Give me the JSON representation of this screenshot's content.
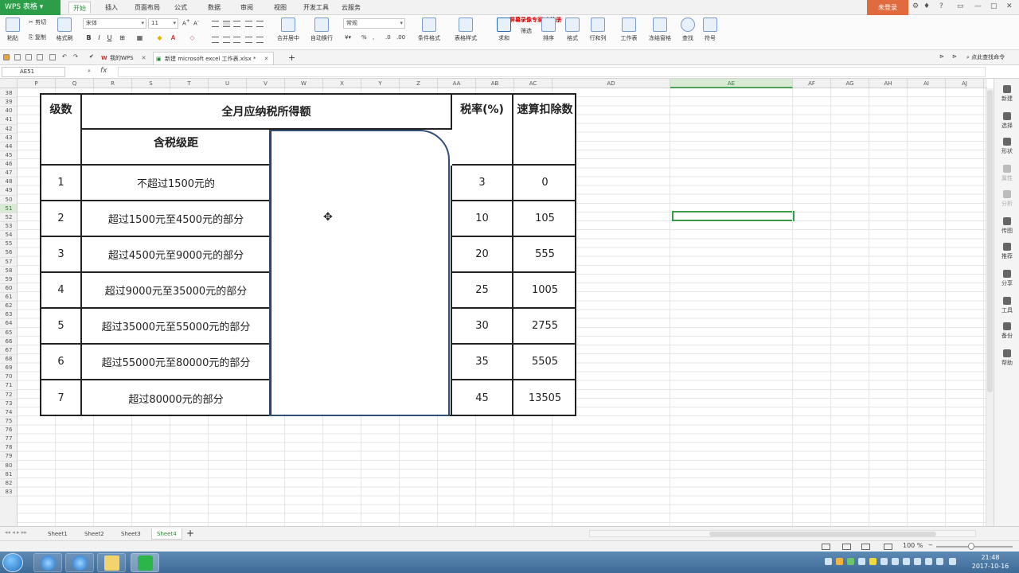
{
  "app": {
    "name": "WPS 表格",
    "login": "未登录"
  },
  "menu": {
    "tabs": [
      "开始",
      "插入",
      "页面布局",
      "公式",
      "数据",
      "审阅",
      "视图",
      "开发工具",
      "云服务"
    ],
    "active": "开始"
  },
  "ribbon": {
    "paste": "粘贴",
    "cut": "剪切",
    "copy": "复制",
    "format_painter": "格式刷",
    "font_name": "宋体",
    "font_size": "11",
    "number_format": "常规",
    "merge_center": "合并居中",
    "wrap_text": "自动换行",
    "cond_format": "条件格式",
    "table_style": "表格样式",
    "sum": "求和",
    "filter": "筛选",
    "sort": "排序",
    "format": "格式",
    "rows_cols": "行和列",
    "worksheet": "工作表",
    "freeze": "冻结窗格",
    "find": "查找",
    "symbol": "符号",
    "warning": "屏幕录像专家 未注册"
  },
  "doc_tabs": [
    {
      "label": "我的WPS"
    },
    {
      "label": "新建 microsoft excel 工作表.xlsx *"
    }
  ],
  "search_hint": "点此查找命令",
  "formula_bar": {
    "name_box": "AE51",
    "fx": "fx",
    "value": ""
  },
  "columns": [
    "P",
    "Q",
    "R",
    "S",
    "T",
    "U",
    "V",
    "W",
    "X",
    "Y",
    "Z",
    "AA",
    "AB",
    "AC",
    "AD",
    "AE",
    "AF",
    "AG",
    "AH",
    "AI",
    "AJ"
  ],
  "selected_column": "AE",
  "rows": [
    38,
    39,
    40,
    41,
    42,
    43,
    44,
    45,
    46,
    47,
    48,
    49,
    50,
    51,
    52,
    53,
    54,
    55,
    56,
    57,
    58,
    59,
    60,
    61,
    62,
    63,
    64,
    65,
    66,
    67,
    68,
    69,
    70,
    71,
    72,
    73,
    74,
    75,
    76,
    77,
    78,
    79,
    80,
    81,
    82,
    83
  ],
  "selected_row": 51,
  "tax_table": {
    "header_level": "级数",
    "header_income": "全月应纳税所得额",
    "header_bracket": "含税级距",
    "header_rate": "税率(%)",
    "header_deduction": "速算扣除数",
    "rows": [
      {
        "level": "1",
        "bracket": "不超过1500元的",
        "rate": "3",
        "deduction": "0"
      },
      {
        "level": "2",
        "bracket": "超过1500元至4500元的部分",
        "rate": "10",
        "deduction": "105"
      },
      {
        "level": "3",
        "bracket": "超过4500元至9000元的部分",
        "rate": "20",
        "deduction": "555"
      },
      {
        "level": "4",
        "bracket": "超过9000元至35000元的部分",
        "rate": "25",
        "deduction": "1005"
      },
      {
        "level": "5",
        "bracket": "超过35000元至55000元的部分",
        "rate": "30",
        "deduction": "2755"
      },
      {
        "level": "6",
        "bracket": "超过55000元至80000元的部分",
        "rate": "35",
        "deduction": "5505"
      },
      {
        "level": "7",
        "bracket": "超过80000元的部分",
        "rate": "45",
        "deduction": "13505"
      }
    ]
  },
  "right_sidebar": [
    {
      "label": "新建",
      "dim": false
    },
    {
      "label": "选择",
      "dim": false
    },
    {
      "label": "形状",
      "dim": false
    },
    {
      "label": "属性",
      "dim": true
    },
    {
      "label": "分析",
      "dim": true
    },
    {
      "label": "传图",
      "dim": false
    },
    {
      "label": "推荐",
      "dim": false
    },
    {
      "label": "分享",
      "dim": false
    },
    {
      "label": "工具",
      "dim": false
    },
    {
      "label": "备份",
      "dim": false
    },
    {
      "label": "帮助",
      "dim": false
    }
  ],
  "sheets": [
    "Sheet1",
    "Sheet2",
    "Sheet3",
    "Sheet4"
  ],
  "active_sheet": "Sheet4",
  "status": {
    "zoom": "100 %"
  },
  "clock": {
    "time": "21:48",
    "date": "2017-10-16"
  },
  "colors": {
    "accent": "#2c9e4a",
    "shape_border": "#2f4f77",
    "login": "#e06b3e"
  }
}
